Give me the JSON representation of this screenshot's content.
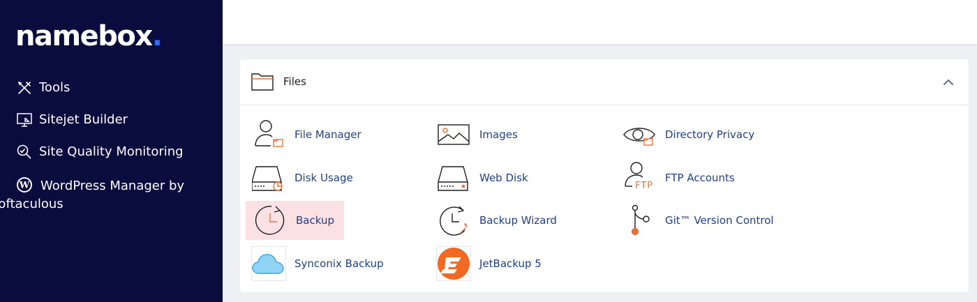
{
  "brand": {
    "name": "namebox",
    "dot": "."
  },
  "sidebar": {
    "items": [
      {
        "label": "Tools",
        "icon": "tools-icon"
      },
      {
        "label": "Sitejet Builder",
        "icon": "monitor-icon"
      },
      {
        "label": "Site Quality Monitoring",
        "icon": "magnifier-icon"
      },
      {
        "label": "WordPress Manager by Softaculous",
        "icon": "wordpress-icon"
      }
    ]
  },
  "panel": {
    "title": "Files",
    "tools": [
      {
        "label": "File Manager",
        "icon": "file-manager-icon"
      },
      {
        "label": "Images",
        "icon": "images-icon"
      },
      {
        "label": "Directory Privacy",
        "icon": "directory-privacy-icon"
      },
      {
        "label": "Disk Usage",
        "icon": "disk-usage-icon"
      },
      {
        "label": "Web Disk",
        "icon": "web-disk-icon"
      },
      {
        "label": "FTP Accounts",
        "icon": "ftp-accounts-icon",
        "badge": "FTP"
      },
      {
        "label": "Backup",
        "icon": "backup-icon"
      },
      {
        "label": "Backup Wizard",
        "icon": "backup-wizard-icon"
      },
      {
        "label": "Git™ Version Control",
        "icon": "git-icon"
      },
      {
        "label": "Synconix Backup",
        "icon": "cloud-icon"
      },
      {
        "label": "JetBackup 5",
        "icon": "jetbackup-icon"
      }
    ]
  },
  "colors": {
    "sidebar_bg": "#0b0c3e",
    "accent_orange": "#e8713a",
    "link_blue": "#1f3f86",
    "highlight": "#fbe0e4",
    "logo_dot": "#2f6cf6"
  }
}
